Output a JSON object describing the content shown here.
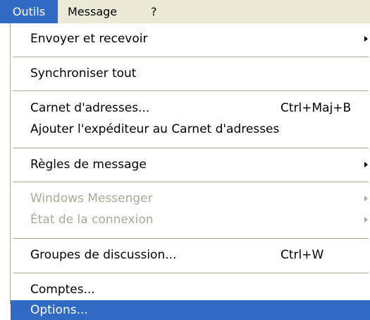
{
  "menubar": {
    "items": [
      {
        "label": "Outils"
      },
      {
        "label": "Message"
      },
      {
        "label": "?"
      }
    ],
    "active_color": "#316ac5",
    "background_color": "#ece9d8"
  },
  "menu": {
    "items": [
      {
        "label": "Envoyer et recevoir",
        "submenu": true,
        "enabled": true
      },
      {
        "label": "Synchroniser tout",
        "enabled": true
      },
      {
        "label": "Carnet d'adresses...",
        "shortcut": "Ctrl+Maj+B",
        "enabled": true
      },
      {
        "label": "Ajouter l'expéditeur au Carnet d'adresses",
        "enabled": true
      },
      {
        "label": "Règles de message",
        "submenu": true,
        "enabled": true
      },
      {
        "label": "Windows Messenger",
        "submenu": true,
        "enabled": false
      },
      {
        "label": "État de la connexion",
        "submenu": true,
        "enabled": false
      },
      {
        "label": "Groupes de discussion...",
        "shortcut": "Ctrl+W",
        "enabled": true
      },
      {
        "label": "Comptes...",
        "enabled": true
      },
      {
        "label": "Options...",
        "enabled": true,
        "highlighted": true
      }
    ],
    "highlight_color": "#316ac5",
    "disabled_text_color": "#aca899"
  }
}
